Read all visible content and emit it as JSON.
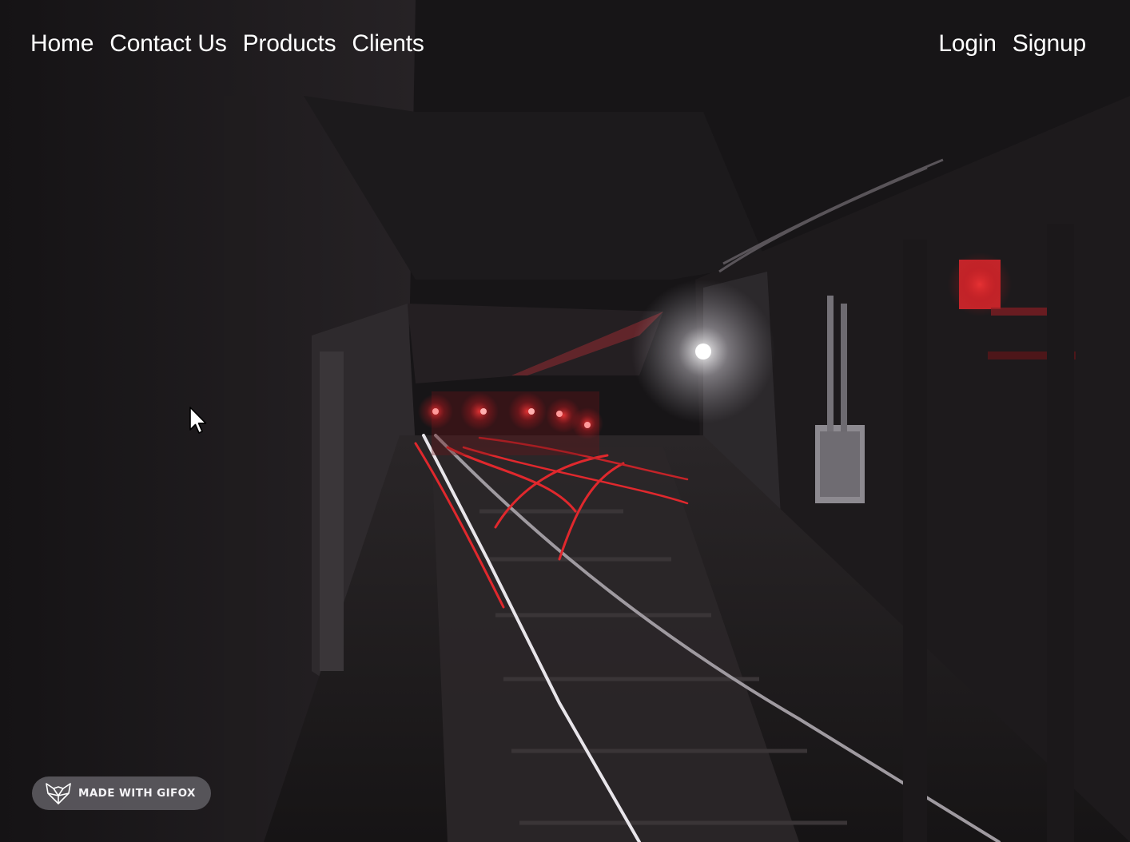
{
  "nav": {
    "left_links": [
      "Home",
      "Contact Us",
      "Products",
      "Clients"
    ],
    "right_links": [
      "Login",
      "Signup"
    ]
  },
  "hero": {
    "image": "subway-tunnel-tracks-red-signal-lights",
    "colors": {
      "background": "#141214",
      "signal_red": "#e0282d",
      "link_text": "#ffffff"
    }
  },
  "badge": {
    "label": "MADE WITH GIFOX",
    "icon": "fox-logo-icon"
  }
}
